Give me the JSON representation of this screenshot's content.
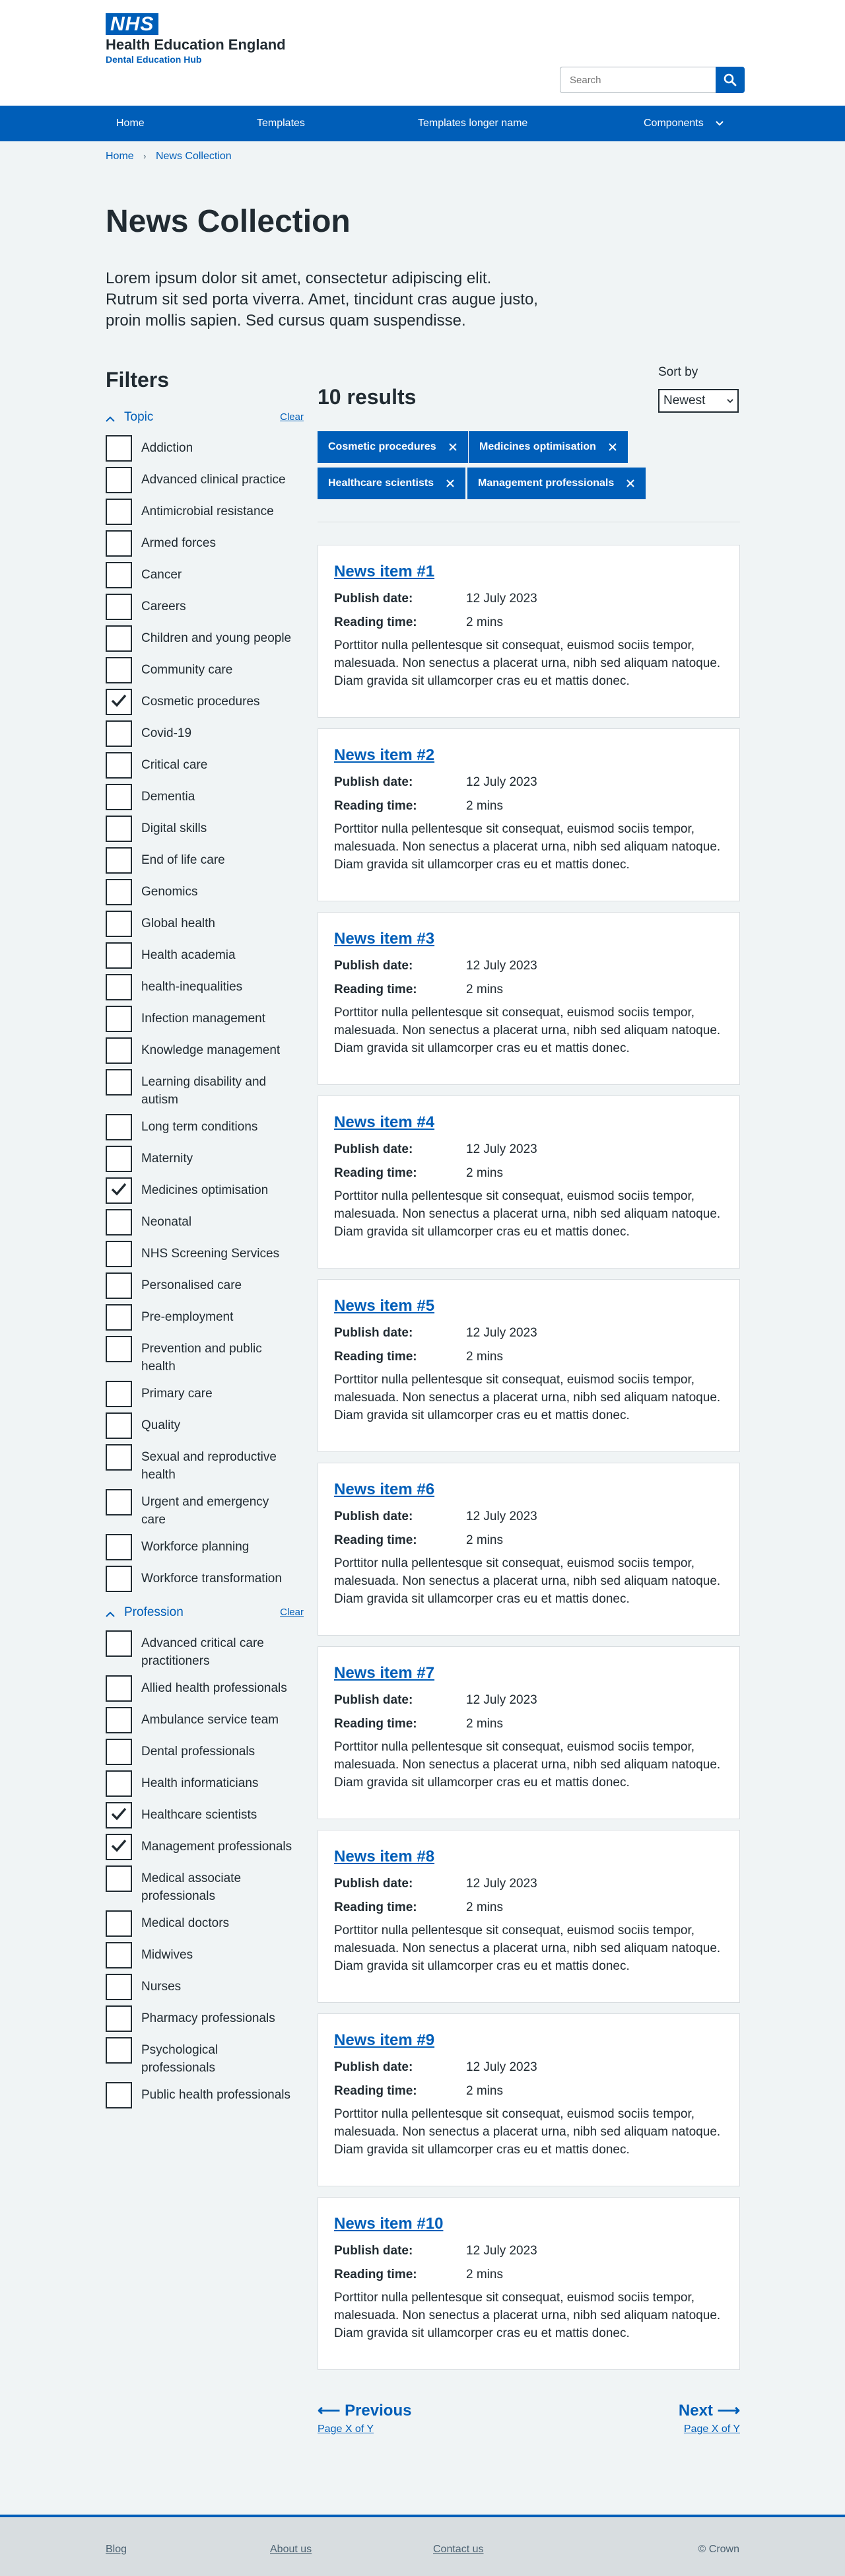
{
  "brand": {
    "logo_text": "NHS",
    "org_name": "Health Education England",
    "org_sub": "Dental Education Hub",
    "primary_color": "#005eb8",
    "text_color": "#212b32",
    "background": "#f0f4f5"
  },
  "search": {
    "placeholder": "Search"
  },
  "nav": {
    "items": [
      {
        "label": "Home"
      },
      {
        "label": "Templates"
      },
      {
        "label": "Templates longer name"
      },
      {
        "label": "Components"
      }
    ]
  },
  "breadcrumb": {
    "items": [
      "Home",
      "News Collection"
    ]
  },
  "page": {
    "title": "News Collection",
    "intro": "Lorem ipsum dolor sit amet, consectetur adipiscing elit. Rutrum sit sed porta viverra. Amet, tincidunt cras augue justo, proin mollis sapien. Sed cursus quam suspendisse."
  },
  "filters": {
    "title": "Filters",
    "groups": [
      {
        "title": "Topic",
        "clear": "Clear",
        "options": [
          {
            "label": "Addiction",
            "checked": false
          },
          {
            "label": "Advanced clinical practice",
            "checked": false
          },
          {
            "label": "Antimicrobial resistance",
            "checked": false
          },
          {
            "label": "Armed forces",
            "checked": false
          },
          {
            "label": "Cancer",
            "checked": false
          },
          {
            "label": "Careers",
            "checked": false
          },
          {
            "label": "Children and young people",
            "checked": false
          },
          {
            "label": "Community care",
            "checked": false
          },
          {
            "label": "Cosmetic procedures",
            "checked": true
          },
          {
            "label": "Covid-19",
            "checked": false
          },
          {
            "label": "Critical care",
            "checked": false
          },
          {
            "label": "Dementia",
            "checked": false
          },
          {
            "label": "Digital skills",
            "checked": false
          },
          {
            "label": "End of life care",
            "checked": false
          },
          {
            "label": "Genomics",
            "checked": false
          },
          {
            "label": "Global health",
            "checked": false
          },
          {
            "label": "Health academia",
            "checked": false
          },
          {
            "label": "health-inequalities",
            "checked": false
          },
          {
            "label": "Infection management",
            "checked": false
          },
          {
            "label": "Knowledge management",
            "checked": false
          },
          {
            "label": "Learning disability and autism",
            "checked": false
          },
          {
            "label": "Long term conditions",
            "checked": false
          },
          {
            "label": "Maternity",
            "checked": false
          },
          {
            "label": "Medicines optimisation",
            "checked": true
          },
          {
            "label": "Neonatal",
            "checked": false
          },
          {
            "label": "NHS Screening Services",
            "checked": false
          },
          {
            "label": "Personalised care",
            "checked": false
          },
          {
            "label": "Pre-employment",
            "checked": false
          },
          {
            "label": "Prevention and public health",
            "checked": false
          },
          {
            "label": "Primary care",
            "checked": false
          },
          {
            "label": "Quality",
            "checked": false
          },
          {
            "label": "Sexual and reproductive health",
            "checked": false
          },
          {
            "label": "Urgent and emergency care",
            "checked": false
          },
          {
            "label": "Workforce planning",
            "checked": false
          },
          {
            "label": "Workforce transformation",
            "checked": false
          }
        ]
      },
      {
        "title": "Profession",
        "clear": "Clear",
        "options": [
          {
            "label": "Advanced critical care practitioners",
            "checked": false
          },
          {
            "label": "Allied health professionals",
            "checked": false
          },
          {
            "label": "Ambulance service team",
            "checked": false
          },
          {
            "label": "Dental professionals",
            "checked": false
          },
          {
            "label": "Health informaticians",
            "checked": false
          },
          {
            "label": "Healthcare scientists",
            "checked": true
          },
          {
            "label": "Management professionals",
            "checked": true
          },
          {
            "label": "Medical associate professionals",
            "checked": false
          },
          {
            "label": "Medical doctors",
            "checked": false
          },
          {
            "label": "Midwives",
            "checked": false
          },
          {
            "label": "Nurses",
            "checked": false
          },
          {
            "label": "Pharmacy professionals",
            "checked": false
          },
          {
            "label": "Psychological professionals",
            "checked": false
          },
          {
            "label": "Public health professionals",
            "checked": false
          }
        ]
      }
    ]
  },
  "results": {
    "count": "10 results",
    "sort_label": "Sort by",
    "sort_value": "Newest",
    "active_tags": [
      "Cosmetic procedures",
      "Medicines optimisation",
      "Healthcare scientists",
      "Management professionals"
    ],
    "items": [
      {
        "title": "News item #1",
        "publish_label": "Publish date:",
        "publish_date": "12 July 2023",
        "reading_label": "Reading time:",
        "reading_time": "2 mins",
        "summary": "Porttitor nulla pellentesque sit consequat, euismod sociis tempor, malesuada. Non senectus a placerat urna, nibh sed aliquam natoque. Diam gravida sit ullamcorper cras eu et mattis donec."
      },
      {
        "title": "News item #2",
        "publish_label": "Publish date:",
        "publish_date": "12 July 2023",
        "reading_label": "Reading time:",
        "reading_time": "2 mins",
        "summary": "Porttitor nulla pellentesque sit consequat, euismod sociis tempor, malesuada. Non senectus a placerat urna, nibh sed aliquam natoque. Diam gravida sit ullamcorper cras eu et mattis donec."
      },
      {
        "title": "News item #3",
        "publish_label": "Publish date:",
        "publish_date": "12 July 2023",
        "reading_label": "Reading time:",
        "reading_time": "2 mins",
        "summary": "Porttitor nulla pellentesque sit consequat, euismod sociis tempor, malesuada. Non senectus a placerat urna, nibh sed aliquam natoque. Diam gravida sit ullamcorper cras eu et mattis donec."
      },
      {
        "title": "News item #4",
        "publish_label": "Publish date:",
        "publish_date": "12 July 2023",
        "reading_label": "Reading time:",
        "reading_time": "2 mins",
        "summary": "Porttitor nulla pellentesque sit consequat, euismod sociis tempor, malesuada. Non senectus a placerat urna, nibh sed aliquam natoque. Diam gravida sit ullamcorper cras eu et mattis donec."
      },
      {
        "title": "News item #5",
        "publish_label": "Publish date:",
        "publish_date": "12 July 2023",
        "reading_label": "Reading time:",
        "reading_time": "2 mins",
        "summary": "Porttitor nulla pellentesque sit consequat, euismod sociis tempor, malesuada. Non senectus a placerat urna, nibh sed aliquam natoque. Diam gravida sit ullamcorper cras eu et mattis donec."
      },
      {
        "title": "News item #6",
        "publish_label": "Publish date:",
        "publish_date": "12 July 2023",
        "reading_label": "Reading time:",
        "reading_time": "2 mins",
        "summary": "Porttitor nulla pellentesque sit consequat, euismod sociis tempor, malesuada. Non senectus a placerat urna, nibh sed aliquam natoque. Diam gravida sit ullamcorper cras eu et mattis donec."
      },
      {
        "title": "News item #7",
        "publish_label": "Publish date:",
        "publish_date": "12 July 2023",
        "reading_label": "Reading time:",
        "reading_time": "2 mins",
        "summary": "Porttitor nulla pellentesque sit consequat, euismod sociis tempor, malesuada. Non senectus a placerat urna, nibh sed aliquam natoque. Diam gravida sit ullamcorper cras eu et mattis donec."
      },
      {
        "title": "News item #8",
        "publish_label": "Publish date:",
        "publish_date": "12 July 2023",
        "reading_label": "Reading time:",
        "reading_time": "2 mins",
        "summary": "Porttitor nulla pellentesque sit consequat, euismod sociis tempor, malesuada. Non senectus a placerat urna, nibh sed aliquam natoque. Diam gravida sit ullamcorper cras eu et mattis donec."
      },
      {
        "title": "News item #9",
        "publish_label": "Publish date:",
        "publish_date": "12 July 2023",
        "reading_label": "Reading time:",
        "reading_time": "2 mins",
        "summary": "Porttitor nulla pellentesque sit consequat, euismod sociis tempor, malesuada. Non senectus a placerat urna, nibh sed aliquam natoque. Diam gravida sit ullamcorper cras eu et mattis donec."
      },
      {
        "title": "News item #10",
        "publish_label": "Publish date:",
        "publish_date": "12 July 2023",
        "reading_label": "Reading time:",
        "reading_time": "2 mins",
        "summary": "Porttitor nulla pellentesque sit consequat, euismod sociis tempor, malesuada. Non senectus a placerat urna, nibh sed aliquam natoque. Diam gravida sit ullamcorper cras eu et mattis donec."
      }
    ]
  },
  "pagination": {
    "prev_label": "Previous",
    "prev_sub": "Page X of Y",
    "next_label": "Next",
    "next_sub": "Page X of Y"
  },
  "footer": {
    "links": [
      "Blog",
      "About us",
      "Contact us"
    ],
    "copyright": "© Crown"
  }
}
